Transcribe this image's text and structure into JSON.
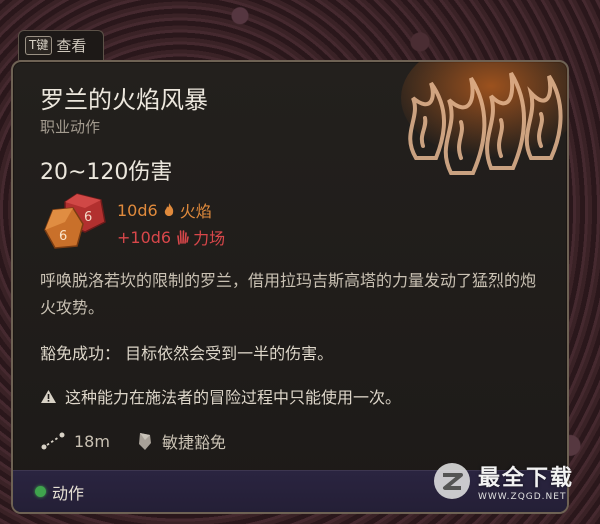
{
  "hint": {
    "key": "T键",
    "label": "查看"
  },
  "tooltip": {
    "title": "罗兰的火焰风暴",
    "subtitle": "职业动作",
    "damage_range": "20~120伤害",
    "rolls": [
      {
        "dice": "10d6",
        "type_icon": "fire-icon",
        "type": "火焰",
        "color": "#e08a3c"
      },
      {
        "dice": "+10d6",
        "type_icon": "force-hand-icon",
        "type": "力场",
        "color": "#d8474a"
      }
    ],
    "description": "呼唤脱洛若坎的限制的罗兰，借用拉玛吉斯高塔的力量发动了猛烈的炮火攻势。",
    "save_text": "豁免成功： 目标依然会受到一半的伤害。",
    "warning_text": "这种能力在施法者的冒险过程中只能使用一次。",
    "range": "18m",
    "save_type": "敏捷豁免",
    "footer_label": "动作"
  },
  "watermark": {
    "title": "最全下载",
    "url": "WWW.ZQGD.NET"
  },
  "colors": {
    "accent_fire": "#e08a3c",
    "accent_force": "#d8474a",
    "footer_dot": "#3fa34d"
  }
}
